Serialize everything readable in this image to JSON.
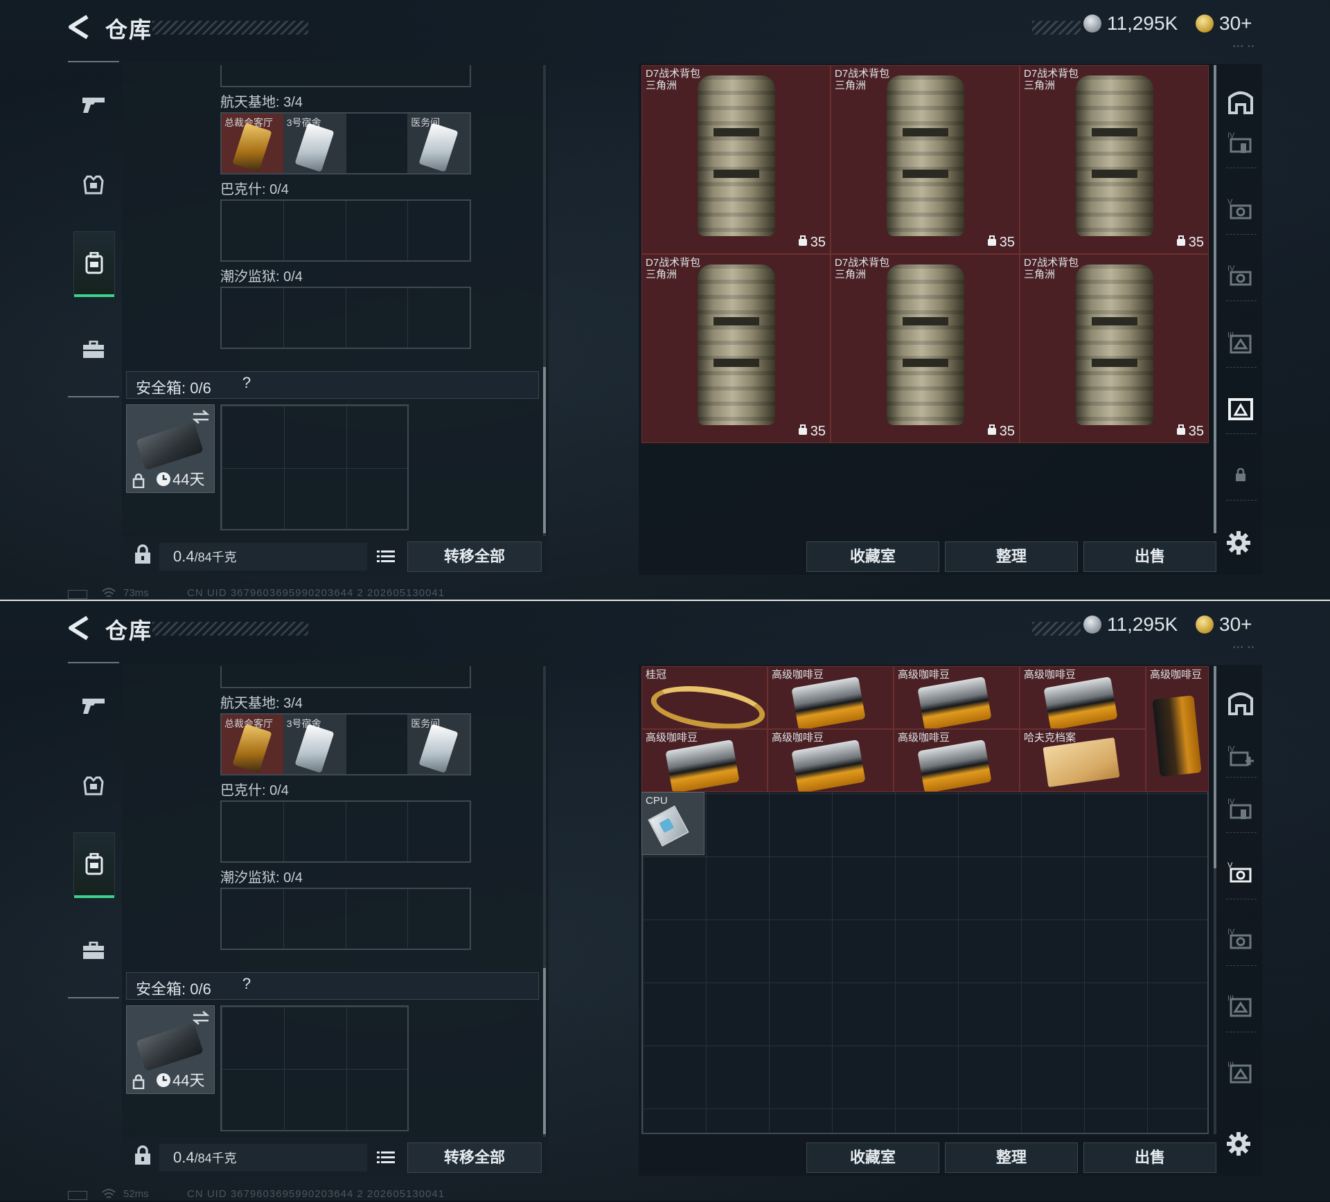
{
  "title": "仓库",
  "currency": {
    "silver": "11,295K",
    "gold": "30+"
  },
  "left_sections": [
    {
      "label": "航天基地: 3/4",
      "cards": [
        "总裁会客厅",
        "3号宿舍",
        "",
        "医务间"
      ]
    },
    {
      "label": "巴克什: 0/4"
    },
    {
      "label": "潮汐监狱: 0/4"
    }
  ],
  "safebox": {
    "label": "安全箱: 0/6",
    "help": "?",
    "days": "44天"
  },
  "bottom": {
    "weight_value": "0.4",
    "weight_unit": "/84千克",
    "transfer_all": "转移全部"
  },
  "actions": {
    "collection": "收藏室",
    "sort": "整理",
    "sell": "出售"
  },
  "status": {
    "screen_a": {
      "ping": "73ms",
      "uid": "CN UID 3679603695990203644 2 202605130041"
    },
    "screen_b": {
      "ping": "52ms",
      "uid": "CN UID 3679603695990203644 2 202605130041"
    }
  },
  "screen_a_items": [
    {
      "name": "D7战术背包",
      "sub": "三角洲",
      "count": "35"
    },
    {
      "name": "D7战术背包",
      "sub": "三角洲",
      "count": "35"
    },
    {
      "name": "D7战术背包",
      "sub": "三角洲",
      "count": "35"
    },
    {
      "name": "D7战术背包",
      "sub": "三角洲",
      "count": "35"
    },
    {
      "name": "D7战术背包",
      "sub": "三角洲",
      "count": "35"
    },
    {
      "name": "D7战术背包",
      "sub": "三角洲",
      "count": "35"
    }
  ],
  "screen_b_items": [
    {
      "name": "桂冠",
      "kind": "crown"
    },
    {
      "name": "高级咖啡豆",
      "kind": "coffee"
    },
    {
      "name": "高级咖啡豆",
      "kind": "coffee"
    },
    {
      "name": "高级咖啡豆",
      "kind": "coffee"
    },
    {
      "name": "高级咖啡豆",
      "kind": "coffee-tall"
    },
    {
      "name": "高级咖啡豆",
      "kind": "coffee"
    },
    {
      "name": "高级咖啡豆",
      "kind": "coffee"
    },
    {
      "name": "高级咖啡豆",
      "kind": "coffee"
    },
    {
      "name": "哈夫克档案",
      "kind": "file"
    },
    {
      "name": "CPU",
      "kind": "cpu"
    }
  ],
  "colors": {
    "accent_green": "#3cd48c",
    "item_red": "#4a2024",
    "panel": "#141d25"
  },
  "icons": {
    "left_nav": [
      "pistol-icon",
      "vest-icon",
      "backpack-icon",
      "briefcase-icon"
    ],
    "right_rail": [
      "stash-home-icon",
      "stash-4-icon",
      "stash-5-icon",
      "stash-6-icon",
      "stash-3-icon",
      "stash-2-icon",
      "lock-icon"
    ]
  }
}
